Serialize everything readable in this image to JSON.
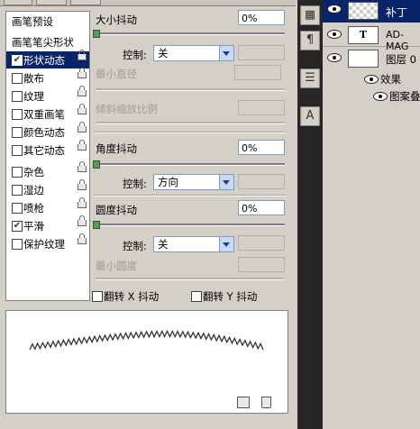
{
  "brush_panel": {
    "presets_label": "画笔预设",
    "tip_shape_label": "画笔笔尖形状",
    "options": [
      {
        "label": "形状动态",
        "checked": true,
        "selected": true
      },
      {
        "label": "散布",
        "checked": false,
        "selected": false
      },
      {
        "label": "纹理",
        "checked": false,
        "selected": false
      },
      {
        "label": "双重画笔",
        "checked": false,
        "selected": false
      },
      {
        "label": "颜色动态",
        "checked": false,
        "selected": false
      },
      {
        "label": "其它动态",
        "checked": false,
        "selected": false
      },
      {
        "label": "杂色",
        "checked": false,
        "selected": false
      },
      {
        "label": "湿边",
        "checked": false,
        "selected": false
      },
      {
        "label": "喷枪",
        "checked": false,
        "selected": false
      },
      {
        "label": "平滑",
        "checked": true,
        "selected": false
      },
      {
        "label": "保护纹理",
        "checked": false,
        "selected": false
      }
    ],
    "size_jitter": {
      "label": "大小抖动",
      "value": "0%",
      "slider_level": 0
    },
    "size_control": {
      "label": "控制:",
      "value": "关"
    },
    "min_diameter": {
      "label": "最小直径"
    },
    "tilt_scale": {
      "label": "倾斜缩放比例"
    },
    "angle_jitter": {
      "label": "角度抖动",
      "value": "0%",
      "slider_level": 0
    },
    "angle_control": {
      "label": "控制:",
      "value": "方向"
    },
    "roundness_jitter": {
      "label": "圆度抖动",
      "value": "0%",
      "slider_level": 0
    },
    "roundness_control": {
      "label": "控制:",
      "value": "关"
    },
    "min_roundness": {
      "label": "最小圆度"
    },
    "flip_x": {
      "label": "翻转 X 抖动",
      "checked": false
    },
    "flip_y": {
      "label": "翻转 Y 抖动",
      "checked": false
    }
  },
  "layers_panel": {
    "layers": [
      {
        "name": "补丁",
        "selected": true
      },
      {
        "name": "AD-MAG",
        "type": "text",
        "thumb_glyph": "T"
      },
      {
        "name": "图层 0"
      }
    ],
    "effects_label": "效果",
    "effect_item": "图案叠"
  },
  "colors": {
    "selection": "#0a246a",
    "panel": "#d4d0c8",
    "dark_bg": "#262626"
  }
}
